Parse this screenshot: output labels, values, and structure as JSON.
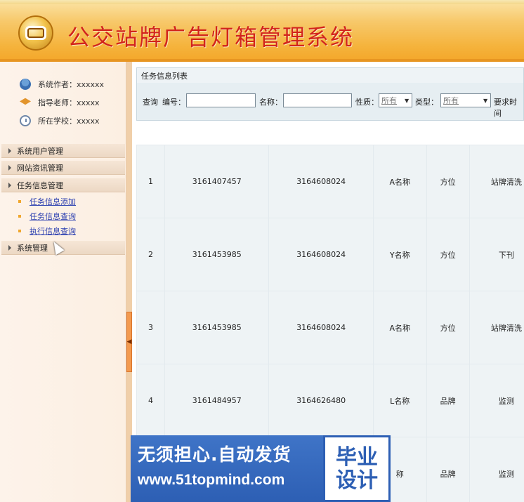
{
  "app": {
    "title": "公交站牌广告灯箱管理系统"
  },
  "sidebar": {
    "info": [
      {
        "icon": "person-icon",
        "label": "系统作者：xxxxxx"
      },
      {
        "icon": "hat-icon",
        "label": "指导老师：xxxxx"
      },
      {
        "icon": "clock-icon",
        "label": "所在学校：xxxxx"
      }
    ],
    "menus": [
      {
        "label": "系统用户管理"
      },
      {
        "label": "网站资讯管理"
      },
      {
        "label": "任务信息管理",
        "items": [
          "任务信息添加",
          "任务信息查询",
          "执行信息查询"
        ]
      },
      {
        "label": "系统管理"
      }
    ]
  },
  "main": {
    "panel_title": "任务信息列表",
    "filters": {
      "query_label": "查询",
      "number_label": "编号：",
      "name_label": "名称：",
      "nature_label": "性质：",
      "nature_value": "所有",
      "type_label": "类型：",
      "type_value": "所有",
      "time_label": "要求时间"
    },
    "table": {
      "rows": [
        [
          "1",
          "3161407457",
          "3164608024",
          "A名称",
          "方位",
          "站牌清洗"
        ],
        [
          "2",
          "3161453985",
          "3164608024",
          "Y名称",
          "方位",
          "下刊"
        ],
        [
          "3",
          "3161453985",
          "3164608024",
          "A名称",
          "方位",
          "站牌清洗"
        ],
        [
          "4",
          "3161484957",
          "3164626480",
          "L名称",
          "品牌",
          "监测"
        ],
        [
          "",
          "",
          "",
          "称",
          "品牌",
          "监测"
        ]
      ]
    }
  },
  "watermark": {
    "line1": "无须担心.自动发货",
    "line2": "www.51topmind.com",
    "badge1": "毕业",
    "badge2": "设计"
  }
}
